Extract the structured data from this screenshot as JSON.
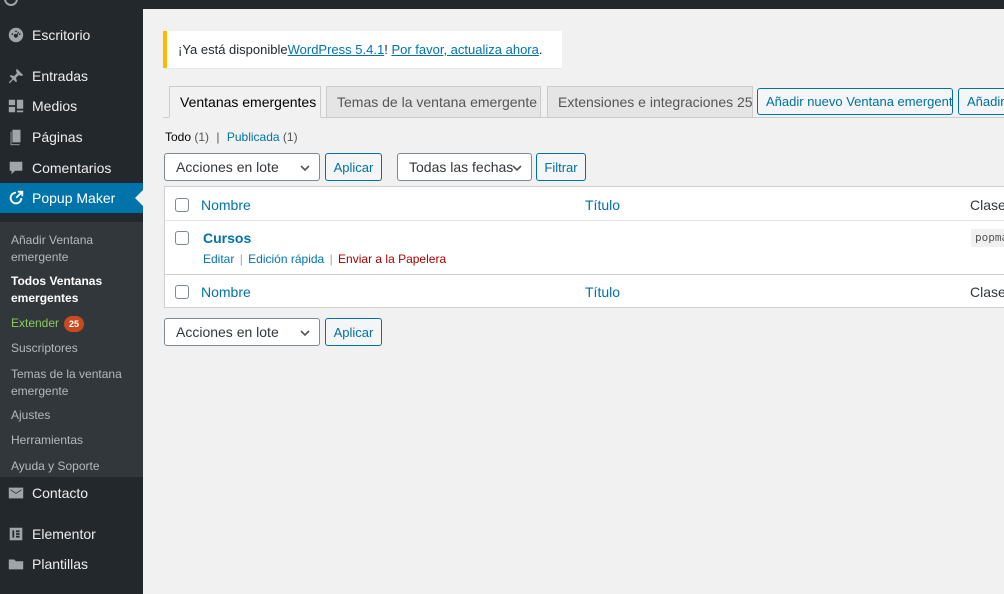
{
  "sidebar": {
    "items": [
      {
        "label": "Escritorio",
        "icon": "dashboard-icon"
      },
      {
        "label": "Entradas",
        "icon": "pin-icon"
      },
      {
        "label": "Medios",
        "icon": "media-icon"
      },
      {
        "label": "Páginas",
        "icon": "pages-icon"
      },
      {
        "label": "Comentarios",
        "icon": "comment-icon"
      },
      {
        "label": "Popup Maker",
        "icon": "popup-maker-icon"
      },
      {
        "label": "Contacto",
        "icon": "mail-icon"
      },
      {
        "label": "Elementor",
        "icon": "elementor-icon"
      },
      {
        "label": "Plantillas",
        "icon": "folder-icon"
      }
    ],
    "submenu": {
      "add_new": "Añadir Ventana emergente",
      "all": "Todos Ventanas emergentes",
      "extend": "Extender",
      "extend_badge": "25",
      "subscribers": "Suscriptores",
      "themes": "Temas de la ventana emergente",
      "settings": "Ajustes",
      "tools": "Herramientas",
      "help": "Ayuda y Soporte"
    }
  },
  "notice": {
    "prefix": "¡Ya está disponible ",
    "link1": "WordPress 5.4.1",
    "middle": "! ",
    "link2": "Por favor, actualiza ahora",
    "suffix": "."
  },
  "tabs": [
    {
      "label": "Ventanas emergentes"
    },
    {
      "label": "Temas de la ventana emergente"
    },
    {
      "label": "Extensiones e integraciones 25"
    }
  ],
  "actions": {
    "add_new_popup": "Añadir nuevo Ventana emergente",
    "add_new_short": "Añadir"
  },
  "filters": {
    "all_label": "Todo",
    "all_count": "(1)",
    "separator": "|",
    "published_label": "Publicada",
    "published_count": "(1)",
    "bulk_actions": "Acciones en lote",
    "apply": "Aplicar",
    "all_dates": "Todas las fechas",
    "filter": "Filtrar"
  },
  "table": {
    "columns": {
      "name": "Nombre",
      "title": "Título",
      "classes": "Clases"
    },
    "rows": [
      {
        "name": "Cursos",
        "actions": {
          "edit": "Editar",
          "quick_edit": "Edición rápida",
          "trash": "Enviar a la Papelera"
        },
        "class_code": "popmake"
      }
    ]
  },
  "colors": {
    "sidebar_bg": "#23282d",
    "accent": "#0073aa",
    "notice_border": "#ffb900",
    "badge": "#ca4a1f",
    "extend_green": "#8ccc59"
  }
}
